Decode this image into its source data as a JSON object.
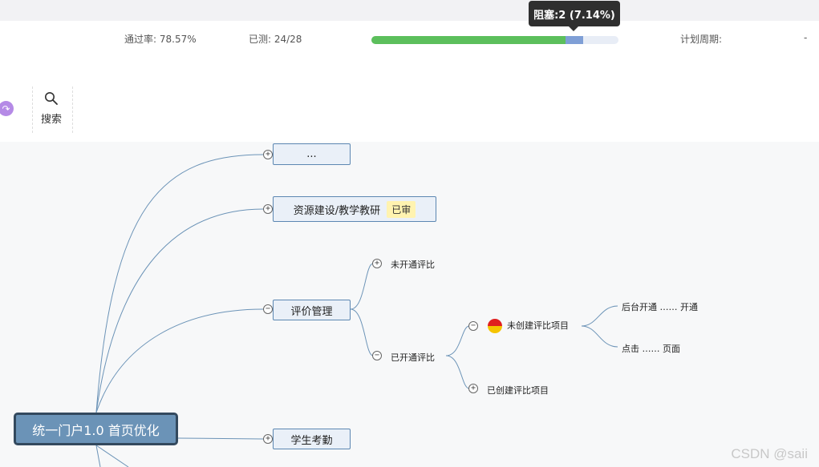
{
  "tooltip": {
    "text": "阻塞:2 (7.14%)"
  },
  "stats": {
    "pass_rate": "通过率: 78.57%",
    "tested": "已测: 24/28",
    "plan_period_label": "计划周期:",
    "plan_period_value": "-"
  },
  "progress": {
    "passed_fraction": 0.7857,
    "blocked_fraction": 0.0714,
    "colors": {
      "passed": "#5cbf5c",
      "blocked": "#7f9fd6",
      "track": "#e8edf6"
    }
  },
  "toolbar": {
    "search_label": "搜索",
    "left_icon": "refresh-icon"
  },
  "mindmap": {
    "root": "统一门户1.0 首页优化",
    "nodes": [
      {
        "label": "... "
      },
      {
        "label": "资源建设/教学教研",
        "badge": "已审"
      },
      {
        "label": "评价管理"
      },
      {
        "label": "学生考勤"
      }
    ],
    "evaluation_children": [
      "未开通评比",
      "已开通评比"
    ],
    "opened_children": [
      "未创建评比项目",
      "已创建评比项目"
    ],
    "not_created_children": [
      "后台开通 …… 开通",
      "点击 …… 页面"
    ]
  },
  "watermark": "CSDN @saii"
}
